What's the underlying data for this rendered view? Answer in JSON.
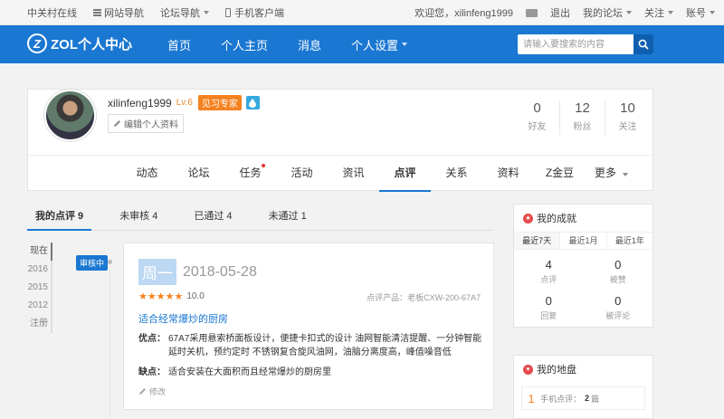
{
  "topbar": {
    "site": "中关村在线",
    "site_nav": "网站导航",
    "forum_nav": "论坛导航",
    "mobile": "手机客户端",
    "welcome": "欢迎您，xilinfeng1999",
    "logout": "退出",
    "my_forum": "我的论坛",
    "follow": "关注",
    "account": "账号"
  },
  "header": {
    "logo_mark": "Z",
    "logo_text": "ZOL个人中心",
    "nav": [
      "首页",
      "个人主页",
      "消息",
      "个人设置"
    ],
    "search_placeholder": "请输入要搜索的内容"
  },
  "profile": {
    "username": "xilinfeng1999",
    "level": "Lv.6",
    "badge": "见习专家",
    "edit_label": "编辑个人资料",
    "stats": [
      {
        "num": "0",
        "label": "好友"
      },
      {
        "num": "12",
        "label": "粉丝"
      },
      {
        "num": "10",
        "label": "关注"
      }
    ],
    "tabs": [
      "动态",
      "论坛",
      "任务",
      "活动",
      "资讯",
      "点评",
      "关系",
      "资料",
      "Z金豆",
      "更多"
    ]
  },
  "reviews": {
    "tabs": [
      "我的点评 9",
      "未审核 4",
      "已通过 4",
      "未通过 1"
    ],
    "years": [
      "现在",
      "2016",
      "2015",
      "2012",
      "注册"
    ],
    "status": "审核中",
    "item": {
      "day": "周一",
      "date": "2018-05-28",
      "stars": "★★★★★",
      "score": "10.0",
      "product": "点评产品：老板CXW-200-67A7",
      "title": "适合经常爆炒的厨房",
      "pros_label": "优点：",
      "pros": "67A7采用悬索桥面板设计，便捷卡扣式的设计 油网智能清洁提醒、一分钟智能延时关机，预约定时 不锈钢复合旋风油网，油脑分离度高，峰值噪音低",
      "cons_label": "缺点：",
      "cons": "适合安装在大面积而且经常爆炒的厨房里",
      "modify": "修改"
    }
  },
  "achievements": {
    "title": "我的成就",
    "tabs": [
      "最近7天",
      "最近1月",
      "最近1年"
    ],
    "cells": [
      {
        "num": "4",
        "label": "点评"
      },
      {
        "num": "0",
        "label": "被赞"
      },
      {
        "num": "0",
        "label": "回复"
      },
      {
        "num": "0",
        "label": "被评论"
      }
    ]
  },
  "territory": {
    "title": "我的地盘",
    "rows": [
      {
        "idx": "1",
        "label": "手机点评：",
        "value": "2",
        "unit": "篇"
      }
    ]
  },
  "colors": {
    "brand": "#1a77d2",
    "accent": "#f58220"
  }
}
